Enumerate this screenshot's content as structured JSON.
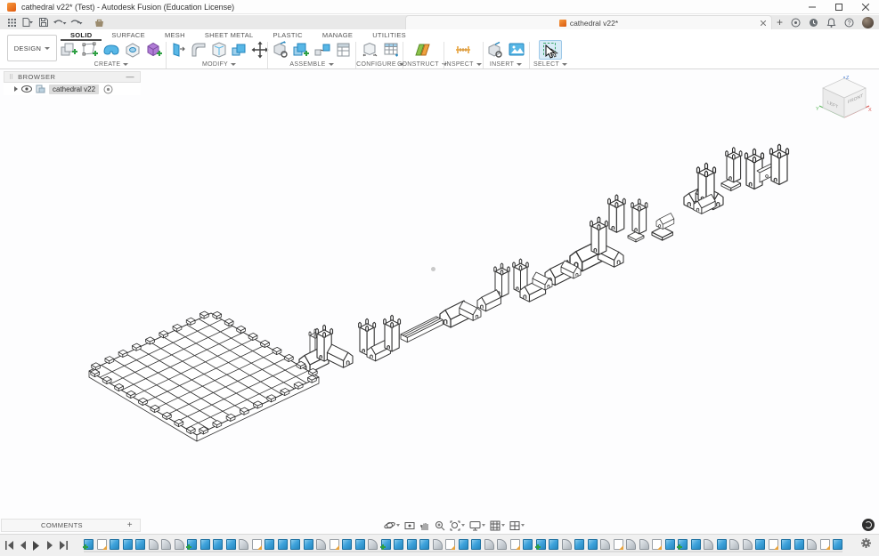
{
  "window": {
    "title": "cathedral v22* (Test) - Autodesk Fusion (Education License)",
    "controls": [
      "minimize",
      "maximize",
      "close"
    ]
  },
  "quick_toolbar": {
    "icons": [
      "app-grid",
      "file-menu",
      "save",
      "undo",
      "redo",
      "toolbox"
    ]
  },
  "tabbar": {
    "tab_label": "cathedral v22*",
    "new_tab_label": "+",
    "right_icons": [
      "extensions",
      "job-status",
      "notifications",
      "help",
      "avatar"
    ]
  },
  "ribbon": {
    "design_label": "DESIGN",
    "tabs": [
      "SOLID",
      "SURFACE",
      "MESH",
      "SHEET METAL",
      "PLASTIC",
      "MANAGE",
      "UTILITIES"
    ],
    "active_tab": "SOLID",
    "groups": [
      {
        "label": "CREATE"
      },
      {
        "label": "MODIFY"
      },
      {
        "label": "ASSEMBLE"
      },
      {
        "label": "CONFIGURE"
      },
      {
        "label": "CONSTRUCT"
      },
      {
        "label": "INSPECT"
      },
      {
        "label": "INSERT"
      },
      {
        "label": "SELECT"
      }
    ]
  },
  "browser": {
    "title": "BROWSER",
    "root_item": "cathedral v22"
  },
  "viewcube": {
    "front_label": "FRONT",
    "left_label": "LEFT",
    "axis_x": "X",
    "axis_y": "Y",
    "axis_z": "Z"
  },
  "comments": {
    "label": "COMMENTS",
    "add_label": "+"
  },
  "navbar": {
    "icons": [
      "orbit",
      "look-at",
      "pan",
      "zoom",
      "fit",
      "display-settings",
      "layout-grid",
      "viewports"
    ]
  },
  "timeline": {
    "legend": {
      "c": "component",
      "s": "sketch",
      "e": "extrude",
      "f": "fillet"
    },
    "feature_sequence": "cseeefffceeefseeeefseefceeefseeffsecefeefsffsecefeffeseefse",
    "controls": [
      "go-to-start",
      "step-back",
      "play",
      "step-forward",
      "go-to-end"
    ]
  },
  "colors": {
    "accent_blue": "#3fa3dc",
    "green_plus": "#2ea043",
    "fusion_orange": "#f6861f",
    "axis_x": "#d9534f",
    "axis_y": "#5cb85c",
    "axis_z": "#4a7fd4"
  }
}
